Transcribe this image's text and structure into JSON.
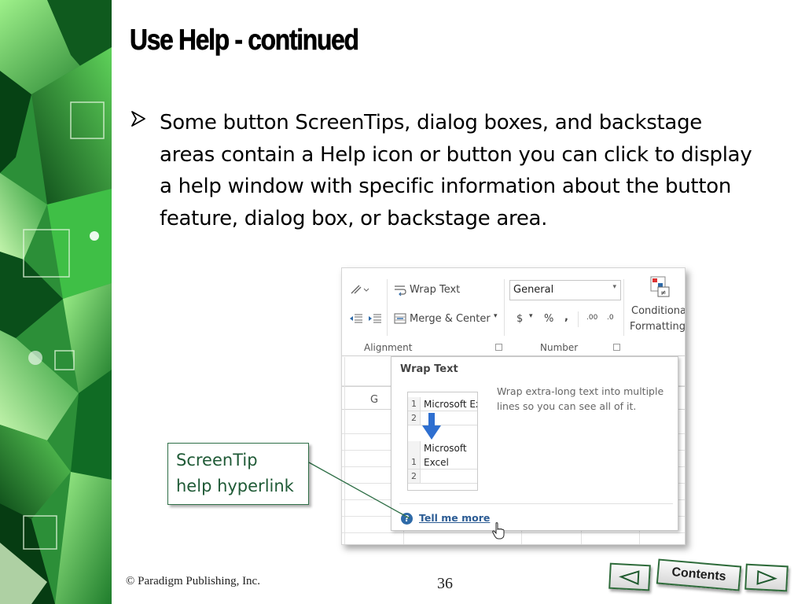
{
  "slide": {
    "title": "Use Help - continued",
    "bullet": "Some button ScreenTips, dialog boxes, and backstage areas contain a Help icon or button you can click to display a help window with specific information about the button feature, dialog box, or backstage area."
  },
  "excel": {
    "ribbon": {
      "wrap_text": "Wrap Text",
      "merge_center": "Merge & Center",
      "number_format": "General",
      "currency": "$",
      "percent": "%",
      "comma": ",",
      "inc_decimal": ".00",
      "dec_decimal": ".0",
      "conditional_line1": "Conditiona",
      "conditional_line2": "Formatting",
      "group_alignment": "Alignment",
      "group_number": "Number"
    },
    "column_header": "G",
    "screentip": {
      "title": "Wrap Text",
      "description": "Wrap extra-long text into multiple lines so you can see all of it.",
      "mini_before": [
        {
          "row": "1",
          "text": "Microsoft Ex"
        },
        {
          "row": "2",
          "text": ""
        }
      ],
      "mini_after_line1": "Microsoft",
      "mini_after": [
        {
          "row": "1",
          "text": "Excel"
        },
        {
          "row": "2",
          "text": ""
        }
      ],
      "help_icon": "?",
      "link": "Tell me more"
    }
  },
  "callout": {
    "line1": "ScreenTip",
    "line2": "help hyperlink"
  },
  "footer": {
    "copyright": "© Paradigm Publishing, Inc.",
    "page_number": "36",
    "contents_label": "Contents"
  },
  "colors": {
    "deco_green": "#2e9e3e",
    "callout_text": "#1f5a36",
    "link_blue": "#2c5c94"
  }
}
